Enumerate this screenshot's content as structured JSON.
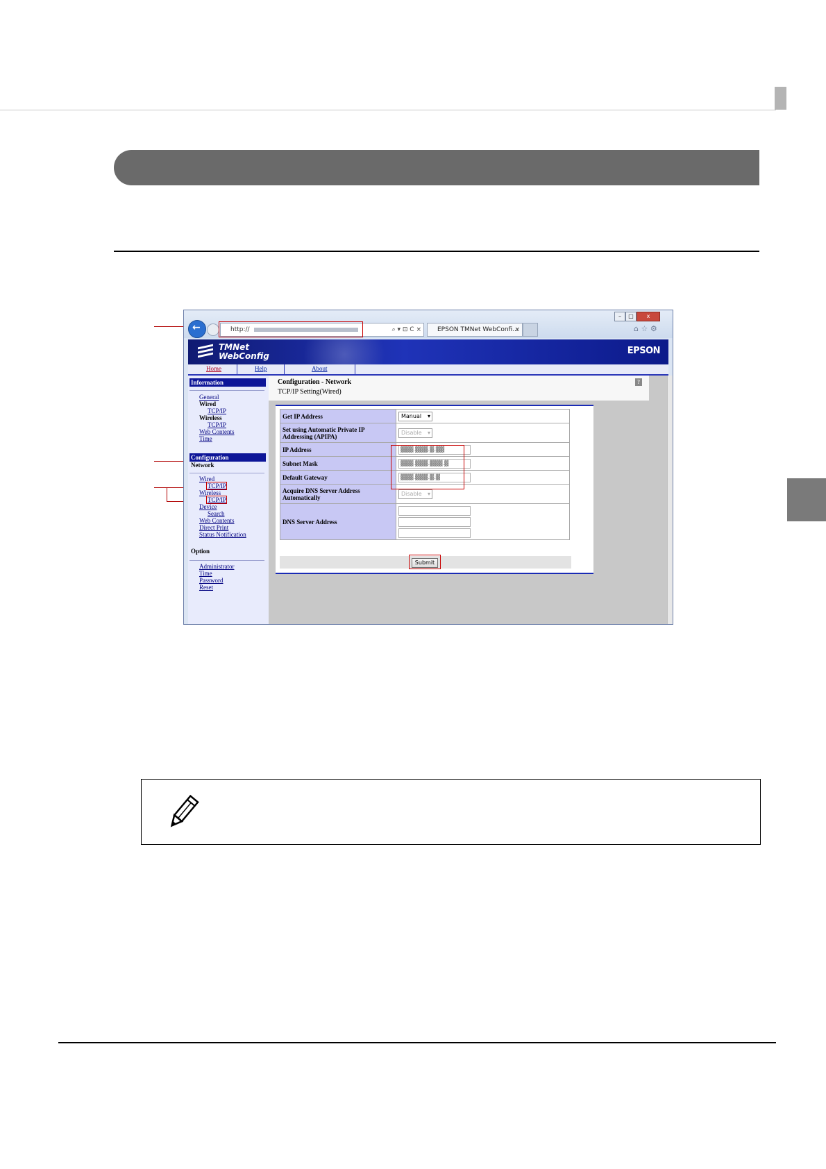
{
  "browser": {
    "address_text": "http://",
    "tab_title": "EPSON TMNet WebConfi...",
    "tab_close": "×",
    "search_glyph": "⌕ ▾ ⊡ C ×",
    "minimize": "–",
    "maximize": "□",
    "close": "x",
    "toolbar_icons": "⌂ ☆ ⚙"
  },
  "webconfig": {
    "title_line1": "TMNet",
    "title_line2": "WebConfig",
    "brand": "EPSON",
    "nav": [
      "Home",
      "Help",
      "About"
    ],
    "sidebar": {
      "information_header": "Information",
      "general": "General",
      "wired": "Wired",
      "wired_tcpip": "TCP/IP",
      "wireless": "Wireless",
      "wireless_tcpip": "TCP/IP",
      "web_contents": "Web Contents",
      "time": "Time",
      "configuration_header": "Configuration",
      "network": "Network",
      "cfg_wired": "Wired",
      "cfg_wired_tcpip": "TCP/IP",
      "cfg_wireless": "Wireless",
      "cfg_wireless_tcpip": "TCP/IP",
      "device": "Device",
      "search": "Search",
      "cfg_web_contents": "Web Contents",
      "direct_print": "Direct Print",
      "status_notification": "Status Notification",
      "option": "Option",
      "administrator": "Administrator",
      "opt_time": "Time",
      "password": "Password",
      "reset": "Reset"
    },
    "main": {
      "title": "Configuration - Network",
      "subtitle": "TCP/IP Setting(Wired)",
      "help_glyph": "?",
      "rows": {
        "get_ip_label": "Get IP Address",
        "get_ip_value": "Manual",
        "apipa_label": "Set using Automatic Private IP Addressing (APIPA)",
        "apipa_value": "Disable",
        "ip_label": "IP Address",
        "ip_value": "▓▓▓.▓▓▓.▓.▓▓",
        "mask_label": "Subnet Mask",
        "mask_value": "▓▓▓.▓▓▓.▓▓▓.▓",
        "gateway_label": "Default Gateway",
        "gateway_value": "▓▓▓.▓▓▓.▓.▓",
        "dns_auto_label": "Acquire DNS Server Address Automatically",
        "dns_auto_value": "Disable",
        "dns_label": "DNS Server Address"
      },
      "submit": "Submit"
    }
  },
  "colors": {
    "callout": "#b00000",
    "banner": "#1f33b8",
    "section_bar": "#6a6a6a"
  }
}
